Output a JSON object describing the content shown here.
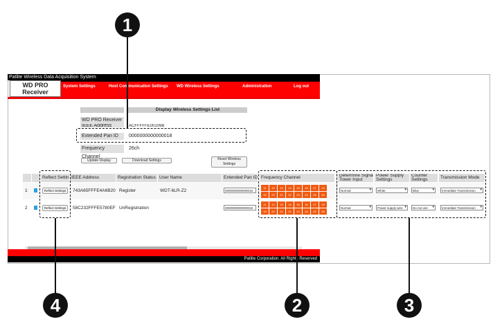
{
  "window": {
    "title": "Patlite Wireless Data Acquisition System"
  },
  "logo": {
    "line1": "WD PRO",
    "line2": "Receiver"
  },
  "nav": {
    "system": "System Settings",
    "host": "Host Communication Settings",
    "wireless": "WD Wireless Settings",
    "admin": "Administration",
    "logout": "Log out"
  },
  "panel": {
    "header": "Display Wireless Settings List",
    "row1_label": "WD PRO Receiver",
    "row2_label": "IEEE Address",
    "row2_value": "ACFFFFFE00109B",
    "row3_label": "Extended Pan ID",
    "row3_value": "0000000000000018",
    "row4_label": "Frequency Channel",
    "row4_value": "26ch"
  },
  "buttons": {
    "update": "Update Display",
    "download": "Download Settings",
    "reset_line1": "Reset Wireless",
    "reset_line2": "Settings"
  },
  "table": {
    "headers": {
      "reflect": "Reflect Settings",
      "ieee": "IEEE Address",
      "status": "Registration Status",
      "user": "User Name",
      "panid": "Extended Pan ID",
      "freq": "Frequency Channel",
      "signal_l1": "Determine Signal",
      "signal_l2": "Tower Input",
      "power_l1": "Power Supply",
      "power_l2": "Settings",
      "counter_l1": "Counter",
      "counter_l2": "Settings",
      "mode": "Transmission Mode"
    },
    "channels": [
      "11",
      "12",
      "13",
      "14",
      "15",
      "16",
      "17",
      "18",
      "19",
      "20",
      "21",
      "22",
      "23",
      "24",
      "25",
      "26"
    ],
    "rows": [
      {
        "num": "1",
        "reflect": "Reflect Settings",
        "ieee": "743A65FFFE4A6B20",
        "status": "Register",
        "user": "WDT-6LR-Z2",
        "panid": "0000000000000018",
        "signal": "Normal",
        "power": "White",
        "counter": "Blue",
        "mode": "Immediate Transmission"
      },
      {
        "num": "2",
        "reflect": "Reflect Settings",
        "ieee": "58C232FFFE5780EF",
        "status": "UnRegistration",
        "user": "",
        "panid": "0000000000000018",
        "signal": "Normal",
        "power": "Power supply wire",
        "counter": "Do not use",
        "mode": "Immediate Transmission"
      }
    ]
  },
  "footer": {
    "copyright": "Patlite Corporation. All Rights Reserved"
  },
  "callouts": {
    "c1": "1",
    "c2": "2",
    "c3": "3",
    "c4": "4"
  },
  "colors": {
    "nav_red": "#ff0000",
    "channel_orange": "#f05a10",
    "callout_black": "#111111"
  }
}
